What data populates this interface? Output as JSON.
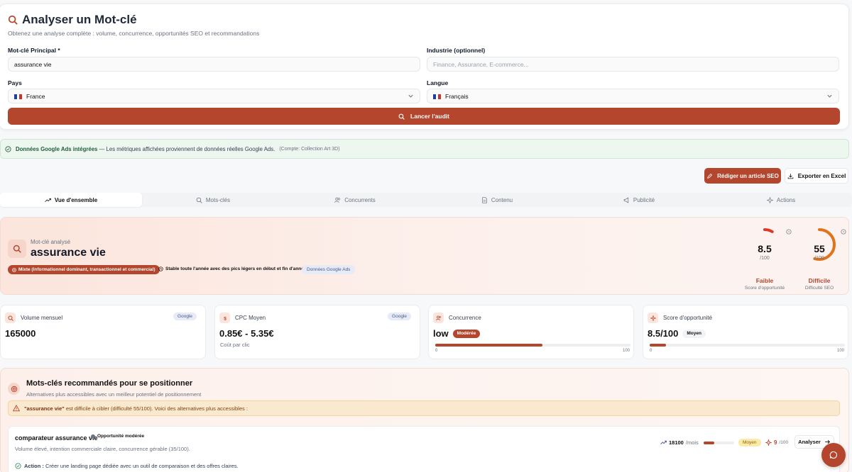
{
  "analyzer": {
    "title": "Analyser un Mot-clé",
    "subtitle": "Obtenez une analyse complète : volume, concurrence, opportunités SEO et recommandations",
    "keyword_label": "Mot-clé Principal *",
    "keyword_value": "assurance vie",
    "industry_label": "Industrie (optionnel)",
    "industry_placeholder": "Finance, Assurance, E-commerce...",
    "country_label": "Pays",
    "country_value": "France",
    "language_label": "Langue",
    "language_value": "Français",
    "audit_button": "Lancer l'audit"
  },
  "banner": {
    "strong": "Données Google Ads intégrées",
    "text": " — Les métriques affichées proviennent de données réelles Google Ads.",
    "account": "(Compte: Collection Art 3D)"
  },
  "actions": {
    "write_article": "Rédiger un article SEO",
    "export_excel": "Exporter en Excel"
  },
  "tabs": [
    {
      "label": "Vue d'ensemble"
    },
    {
      "label": "Mots-clés"
    },
    {
      "label": "Concurrents"
    },
    {
      "label": "Contenu"
    },
    {
      "label": "Publicité"
    },
    {
      "label": "Actions"
    }
  ],
  "hero": {
    "label": "Mot-clé analysé",
    "keyword": "assurance vie",
    "intent": "Mixte (Informationnel dominant, transactionnel et commercial)",
    "seasonality": "Stable toute l'année avec des pics légers en début et fin d'année",
    "source_badge": "Données Google Ads",
    "opportunity": {
      "value": "8.5",
      "den": "/100",
      "level": "Faible",
      "caption": "Score d'opportunité",
      "score": 8.5
    },
    "difficulty": {
      "value": "55",
      "den": "/100",
      "level": "Difficile",
      "caption": "Difficulté SEO",
      "score": 55
    }
  },
  "metrics": {
    "volume": {
      "title": "Volume mensuel",
      "tag": "Google",
      "value": "165000"
    },
    "cpc": {
      "title": "CPC Moyen",
      "tag": "Google",
      "value": "0.85€ - 5.35€",
      "sub": "Coût par clic"
    },
    "competition": {
      "title": "Concurrence",
      "value": "low",
      "badge": "Modérée",
      "min": "0",
      "max": "100",
      "level": 55
    },
    "opportunity": {
      "title": "Score d'opportunité",
      "value": "8.5/100",
      "badge": "Moyen",
      "min": "0",
      "max": "100",
      "level": 8.5
    }
  },
  "reco": {
    "title": "Mots-clés recommandés pour se positionner",
    "subtitle": "Alternatives plus accessibles avec un meilleur potentiel de positionnement",
    "warning_kw": "\"assurance vie\"",
    "warning_text": " est difficile à cibler (difficulté 55/100). Voici des alternatives plus accessibles :",
    "items": [
      {
        "keyword": "comparateur assurance vie",
        "opportunity": "Opportunité modérée",
        "desc": "Volume élevé, intention commerciale claire, concurrence gérable (35/100).",
        "volume": "18100",
        "volume_unit": "/mois",
        "difficulty": 35,
        "difficulty_label": "Moyen",
        "score": "9",
        "score_unit": "/100",
        "analyze": "Analyser",
        "action_label": "Action :",
        "action_text": " Créer une landing page dédiée avec un outil de comparaison et des offres claires."
      }
    ]
  },
  "colors": {
    "accent": "#b3462c",
    "success_bg": "#eef6f0",
    "warning_bg": "#fbe9cf"
  }
}
